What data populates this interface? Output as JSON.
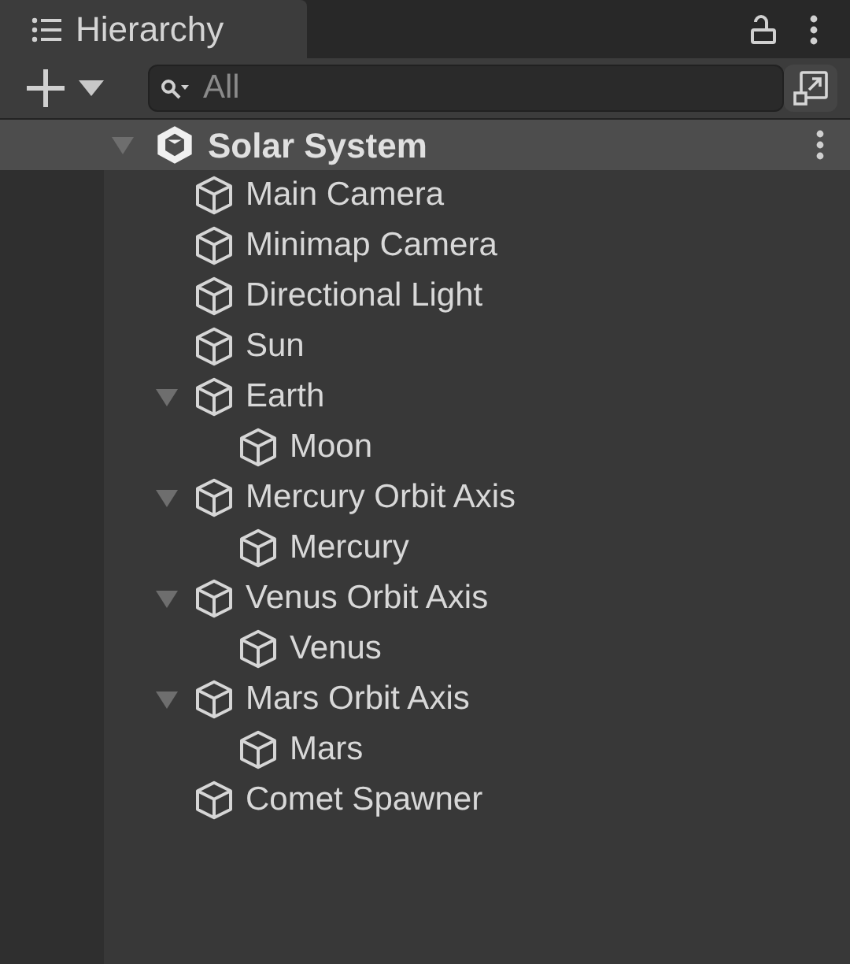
{
  "tab": {
    "title": "Hierarchy",
    "selected": true
  },
  "search": {
    "placeholder": "All"
  },
  "scene": {
    "name": "Solar System",
    "expanded": true,
    "children": [
      {
        "name": "Main Camera"
      },
      {
        "name": "Minimap Camera"
      },
      {
        "name": "Directional Light"
      },
      {
        "name": "Sun"
      },
      {
        "name": "Earth",
        "expanded": true,
        "children": [
          {
            "name": "Moon"
          }
        ]
      },
      {
        "name": "Mercury Orbit Axis",
        "expanded": true,
        "children": [
          {
            "name": "Mercury"
          }
        ]
      },
      {
        "name": "Venus Orbit Axis",
        "expanded": true,
        "children": [
          {
            "name": "Venus"
          }
        ]
      },
      {
        "name": "Mars Orbit Axis",
        "expanded": true,
        "children": [
          {
            "name": "Mars"
          }
        ]
      },
      {
        "name": "Comet Spawner"
      }
    ]
  }
}
